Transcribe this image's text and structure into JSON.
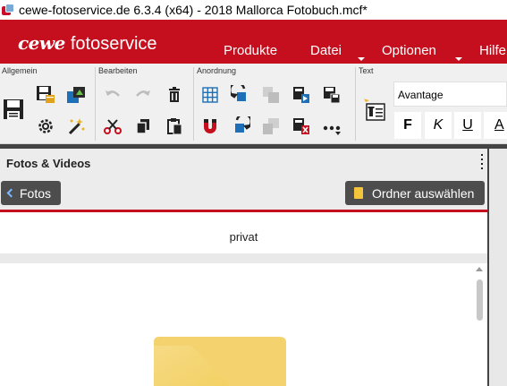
{
  "window": {
    "title": "cewe-fotoservice.de 6.3.4 (x64) - 2018 Mallorca Fotobuch.mcf*",
    "app_icon": "cewe-app-icon"
  },
  "brand": {
    "logo_cewe": "cewe",
    "logo_fotoservice": "fotoservice",
    "color": "#c50f1e"
  },
  "menu": {
    "produkte": "Produkte",
    "datei": "Datei",
    "optionen": "Optionen",
    "hilfe": "Hilfe"
  },
  "ribbon": {
    "groups": {
      "allgemein": "Allgemein",
      "bearbeiten": "Bearbeiten",
      "anordnung": "Anordnung",
      "text": "Text"
    },
    "font_family": "Avantage",
    "format_buttons": {
      "bold": "F",
      "italic": "K",
      "underline": "U",
      "color": "A"
    },
    "icons": [
      "save-icon",
      "save-as-icon",
      "settings-icon",
      "upload-icon",
      "magic-wand-icon",
      "undo-icon",
      "redo-icon",
      "delete-icon",
      "cut-icon",
      "copy-icon",
      "paste-icon",
      "grid-icon",
      "rotate-left-icon",
      "bring-forward-icon",
      "move-forward-icon",
      "save-page-icon",
      "magnet-icon",
      "rotate-right-icon",
      "send-backward-icon",
      "remove-page-icon",
      "more-icon",
      "add-text-icon"
    ]
  },
  "panel": {
    "title": "Fotos & Videos",
    "back_label": "Fotos",
    "folder_button_label": "Ordner auswählen",
    "current_folder": "privat",
    "accent_color": "#c50f1e",
    "folder_color": "#f3c53a"
  }
}
